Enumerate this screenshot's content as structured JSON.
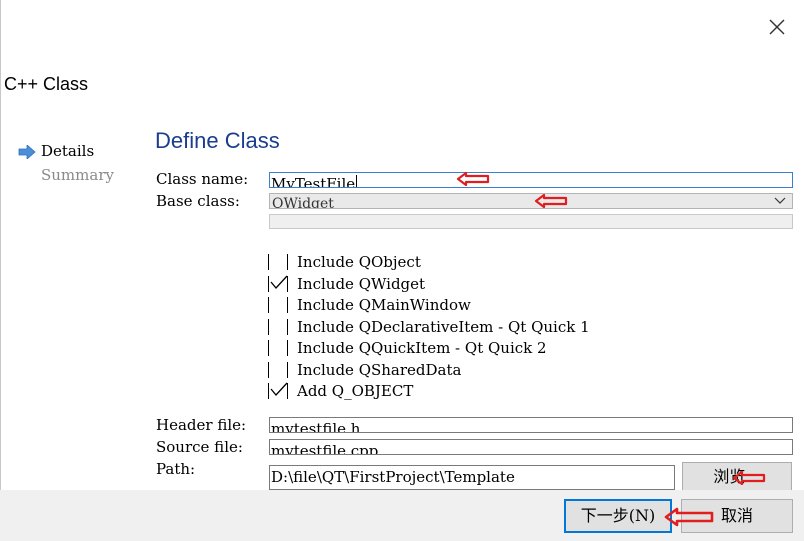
{
  "window": {
    "title": "C++ Class",
    "close_icon": "close-icon"
  },
  "sidebar": {
    "items": [
      {
        "label": "Details",
        "active": true,
        "icon": "arrow-right-icon"
      },
      {
        "label": "Summary",
        "active": false
      }
    ]
  },
  "form": {
    "heading": "Define Class",
    "class_name_label": "Class name:",
    "class_name_value": "MyTestFile",
    "base_class_label": "Base class:",
    "base_class_value": "QWidget",
    "checkboxes": [
      {
        "label": "Include QObject",
        "checked": false
      },
      {
        "label": "Include QWidget",
        "checked": true
      },
      {
        "label": "Include QMainWindow",
        "checked": false
      },
      {
        "label": "Include QDeclarativeItem - Qt Quick 1",
        "checked": false
      },
      {
        "label": "Include QQuickItem - Qt Quick 2",
        "checked": false
      },
      {
        "label": "Include QSharedData",
        "checked": false
      },
      {
        "label": "Add Q_OBJECT",
        "checked": true
      }
    ],
    "header_file_label": "Header file:",
    "header_file_value": "mytestfile.h",
    "source_file_label": "Source file:",
    "source_file_value": "mytestfile.cpp",
    "path_label": "Path:",
    "path_value": "D:\\file\\QT\\FirstProject\\Template",
    "browse_label": "浏览..."
  },
  "footer": {
    "next_label": "下一步(N)",
    "cancel_label": "取消"
  },
  "colors": {
    "heading": "#1a3d8f",
    "annotation_arrow": "#e11d1d",
    "primary_border": "#0078d7",
    "nav_arrow": "#4a8fd8"
  }
}
